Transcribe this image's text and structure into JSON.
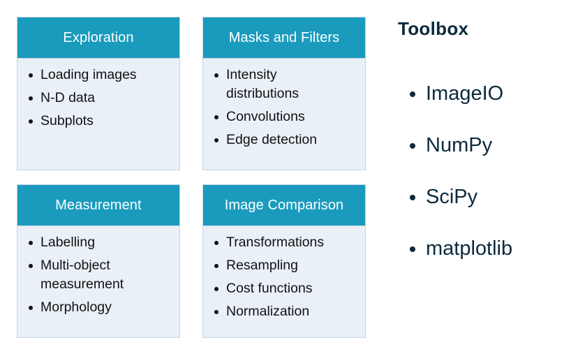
{
  "cards": [
    {
      "title": "Exploration",
      "items": [
        "Loading images",
        "N-D data",
        "Subplots"
      ]
    },
    {
      "title": "Masks and Filters",
      "items": [
        "Intensity distributions",
        "Convolutions",
        "Edge detection"
      ]
    },
    {
      "title": "Measurement",
      "items": [
        "Labelling",
        "Multi-object measurement",
        "Morphology"
      ]
    },
    {
      "title": "Image Comparison",
      "items": [
        "Transformations",
        "Resampling",
        "Cost functions",
        "Normalization"
      ]
    }
  ],
  "toolbox": {
    "title": "Toolbox",
    "items": [
      "ImageIO",
      "NumPy",
      "SciPy",
      "matplotlib"
    ]
  },
  "colors": {
    "header": "#1a9bbd",
    "card_body": "#eaf0f8",
    "toolbox_text": "#0b2a3c"
  }
}
